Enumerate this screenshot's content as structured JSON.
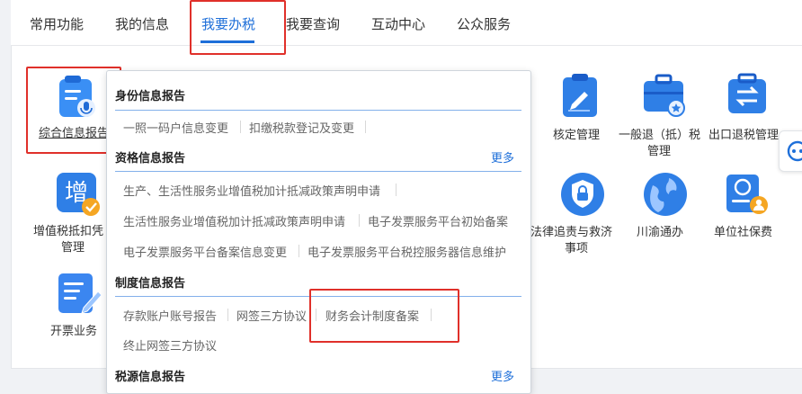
{
  "tabs": [
    "常用功能",
    "我的信息",
    "我要办税",
    "我要查询",
    "互动中心",
    "公众服务"
  ],
  "apps": {
    "comprehensive_report": "综合信息报告",
    "vat_deduction_line1": "增值税抵扣凭",
    "vat_deduction_line2": "管理",
    "invoicing": "开票业务",
    "verification": "核定管理",
    "general_refund_line1": "一般退（抵）税",
    "general_refund_line2": "管理",
    "export_refund": "出口退税管理",
    "legal_remedy_line1": "法律追责与救济",
    "legal_remedy_line2": "事项",
    "chuanyu": "川渝通办",
    "social_insurance": "单位社保费"
  },
  "dropdown": {
    "identity": {
      "title": "身份信息报告",
      "items": [
        "一照一码户信息变更",
        "扣缴税款登记及变更"
      ]
    },
    "qualification": {
      "title": "资格信息报告",
      "more": "更多",
      "items": [
        "生产、生活性服务业增值税加计抵减政策声明申请",
        "生活性服务业增值税加计抵减政策声明申请",
        "电子发票服务平台初始备案",
        "电子发票服务平台备案信息变更",
        "电子发票服务平台税控服务器信息维护"
      ]
    },
    "system": {
      "title": "制度信息报告",
      "items": [
        "存款账户账号报告",
        "网签三方协议",
        "财务会计制度备案",
        "终止网签三方协议"
      ]
    },
    "tax_source": {
      "title": "税源信息报告",
      "more": "更多"
    }
  },
  "colors": {
    "accent": "#1e6fd9",
    "highlight_box": "#e0302a"
  }
}
